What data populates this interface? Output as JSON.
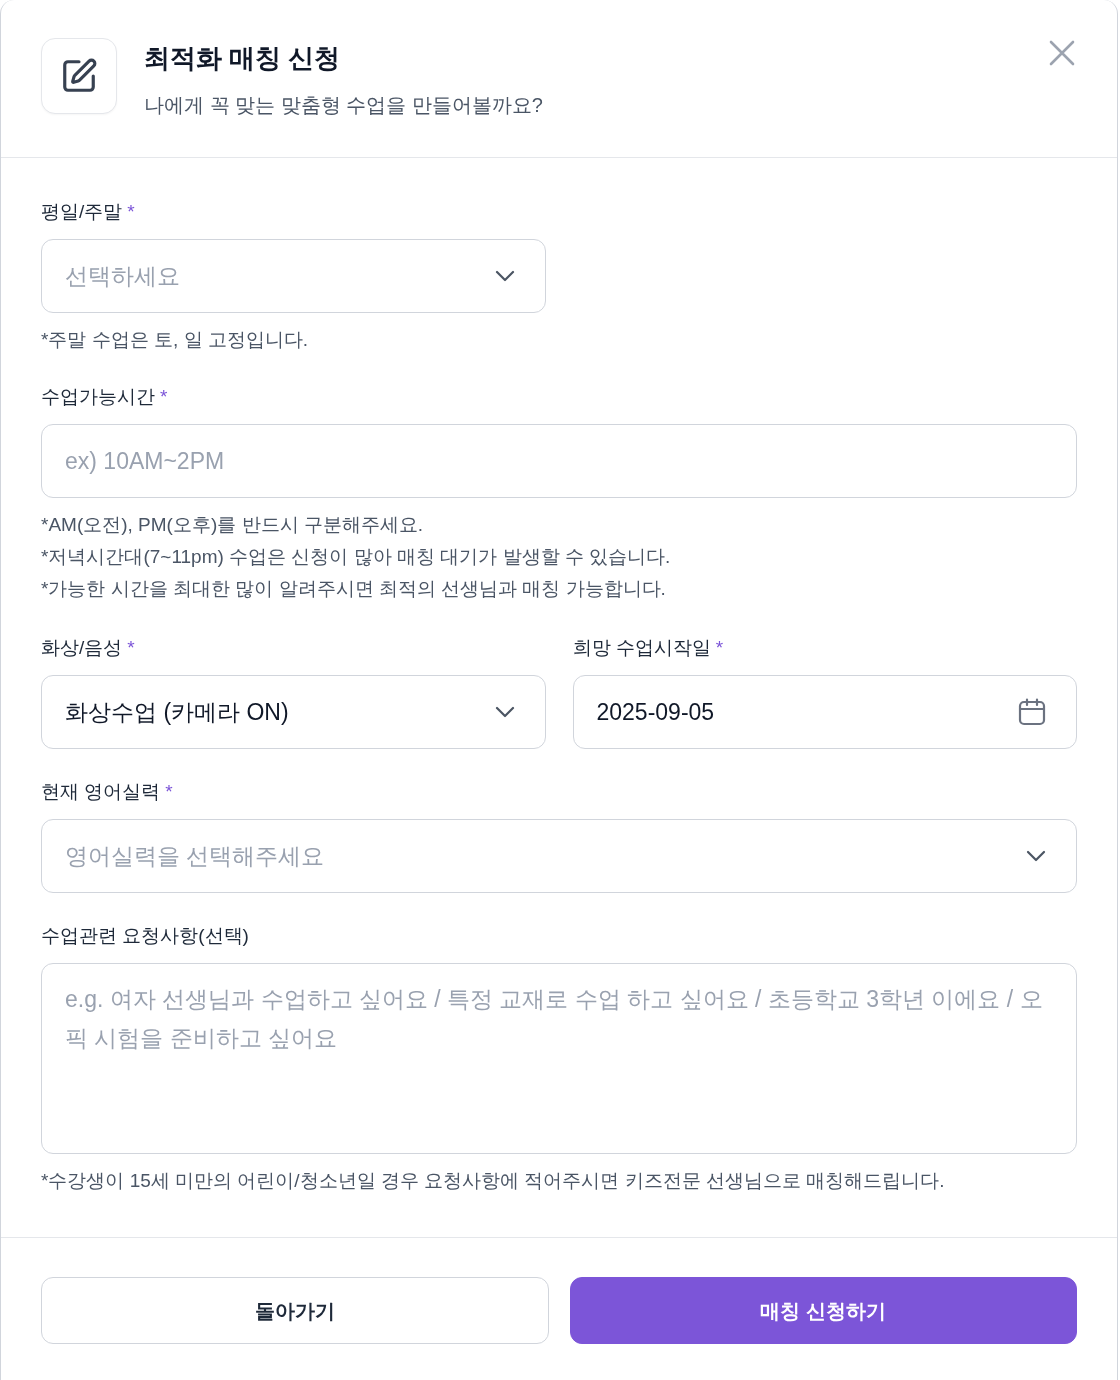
{
  "dialog": {
    "title": "최적화 매칭 신청",
    "subtitle": "나에게 꼭 맞는 맞춤형 수업을 만들어볼까요?"
  },
  "form": {
    "rows": [
      {
        "fields": [
          {
            "kind": "select",
            "label": "평일/주말",
            "required_mark": "*",
            "placeholder": "선택하세요",
            "full_width": false,
            "hints": [
              "*주말 수업은 토, 일 고정입니다."
            ]
          }
        ]
      },
      {
        "fields": [
          {
            "kind": "text",
            "label": "수업가능시간",
            "required_mark": "*",
            "placeholder": "ex) 10AM~2PM",
            "full_width": true,
            "hints": [
              "*AM(오전), PM(오후)를 반드시 구분해주세요.",
              "*저녁시간대(7~11pm) 수업은 신청이 많아 매칭 대기가 발생할 수 있습니다.",
              "*가능한 시간을 최대한 많이 알려주시면 최적의 선생님과 매칭 가능합니다."
            ]
          }
        ]
      },
      {
        "fields": [
          {
            "kind": "select",
            "label": "화상/음성",
            "required_mark": "*",
            "value": "화상수업 (카메라 ON)",
            "full_width": false
          },
          {
            "kind": "date",
            "label": "희망 수업시작일",
            "required_mark": "*",
            "value": "2025-09-05",
            "full_width": false
          }
        ]
      },
      {
        "fields": [
          {
            "kind": "select",
            "label": "현재 영어실력",
            "required_mark": "*",
            "placeholder": "영어실력을 선택해주세요",
            "full_width": true
          }
        ]
      },
      {
        "fields": [
          {
            "kind": "textarea",
            "label": "수업관련 요청사항(선택)",
            "placeholder": "e.g. 여자 선생님과 수업하고 싶어요 / 특정 교재로 수업 하고 싶어요 / 초등학교 3학년 이에요 / 오픽 시험을 준비하고 싶어요",
            "full_width": true,
            "hints": [
              "*수강생이 15세 미만의 어린이/청소년일 경우 요청사항에 적어주시면 키즈전문 선생님으로 매칭해드립니다."
            ]
          }
        ]
      }
    ]
  },
  "buttons": [
    {
      "label": "돌아가기",
      "kind": "secondary"
    },
    {
      "label": "매칭 신청하기",
      "kind": "primary"
    }
  ]
}
